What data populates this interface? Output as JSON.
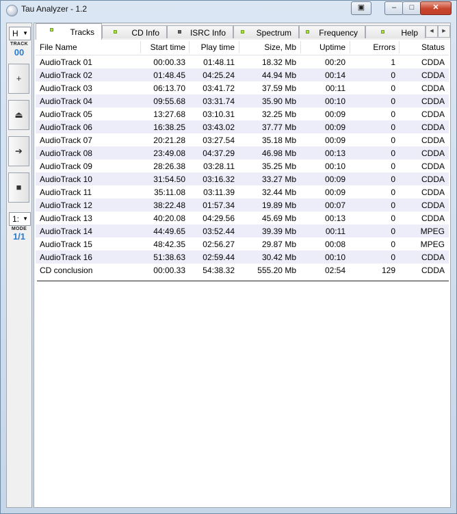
{
  "window": {
    "title": "Tau Analyzer - 1.2",
    "controls": {
      "extra": "▣",
      "minimize": "–",
      "maximize": "□",
      "close": "✕"
    }
  },
  "left_panel": {
    "track_combo": "H",
    "track_label": "TRACK",
    "track_value": "00",
    "mode_combo": "1:",
    "mode_label": "MODE",
    "mode_value": "1/1",
    "buttons": {
      "add": "+",
      "eject": "⏏",
      "play": "➔",
      "stop": "■"
    }
  },
  "tabs": [
    {
      "label": "Tracks",
      "led": "green"
    },
    {
      "label": "CD Info",
      "led": "green"
    },
    {
      "label": "ISRC Info",
      "led": "dark"
    },
    {
      "label": "Spectrum",
      "led": "green"
    },
    {
      "label": "Frequency",
      "led": "green"
    },
    {
      "label": "Help",
      "led": "green"
    }
  ],
  "tab_scroll": {
    "left": "◀",
    "right": "▶"
  },
  "columns": [
    "File Name",
    "Start time",
    "Play time",
    "Size, Mb",
    "Uptime",
    "Errors",
    "Status"
  ],
  "rows": [
    [
      "AudioTrack 01",
      "00:00.33",
      "01:48.11",
      "18.32 Mb",
      "00:20",
      "1",
      "CDDA"
    ],
    [
      "AudioTrack 02",
      "01:48.45",
      "04:25.24",
      "44.94 Mb",
      "00:14",
      "0",
      "CDDA"
    ],
    [
      "AudioTrack 03",
      "06:13.70",
      "03:41.72",
      "37.59 Mb",
      "00:11",
      "0",
      "CDDA"
    ],
    [
      "AudioTrack 04",
      "09:55.68",
      "03:31.74",
      "35.90 Mb",
      "00:10",
      "0",
      "CDDA"
    ],
    [
      "AudioTrack 05",
      "13:27.68",
      "03:10.31",
      "32.25 Mb",
      "00:09",
      "0",
      "CDDA"
    ],
    [
      "AudioTrack 06",
      "16:38.25",
      "03:43.02",
      "37.77 Mb",
      "00:09",
      "0",
      "CDDA"
    ],
    [
      "AudioTrack 07",
      "20:21.28",
      "03:27.54",
      "35.18 Mb",
      "00:09",
      "0",
      "CDDA"
    ],
    [
      "AudioTrack 08",
      "23:49.08",
      "04:37.29",
      "46.98 Mb",
      "00:13",
      "0",
      "CDDA"
    ],
    [
      "AudioTrack 09",
      "28:26.38",
      "03:28.11",
      "35.25 Mb",
      "00:10",
      "0",
      "CDDA"
    ],
    [
      "AudioTrack 10",
      "31:54.50",
      "03:16.32",
      "33.27 Mb",
      "00:09",
      "0",
      "CDDA"
    ],
    [
      "AudioTrack 11",
      "35:11.08",
      "03:11.39",
      "32.44 Mb",
      "00:09",
      "0",
      "CDDA"
    ],
    [
      "AudioTrack 12",
      "38:22.48",
      "01:57.34",
      "19.89 Mb",
      "00:07",
      "0",
      "CDDA"
    ],
    [
      "AudioTrack 13",
      "40:20.08",
      "04:29.56",
      "45.69 Mb",
      "00:13",
      "0",
      "CDDA"
    ],
    [
      "AudioTrack 14",
      "44:49.65",
      "03:52.44",
      "39.39 Mb",
      "00:11",
      "0",
      "MPEG"
    ],
    [
      "AudioTrack 15",
      "48:42.35",
      "02:56.27",
      "29.87 Mb",
      "00:08",
      "0",
      "MPEG"
    ],
    [
      "AudioTrack 16",
      "51:38.63",
      "02:59.44",
      "30.42 Mb",
      "00:10",
      "0",
      "CDDA"
    ]
  ],
  "summary": [
    "CD conclusion",
    "00:00.33",
    "54:38.32",
    "555.20 Mb",
    "02:54",
    "129",
    "CDDA"
  ]
}
